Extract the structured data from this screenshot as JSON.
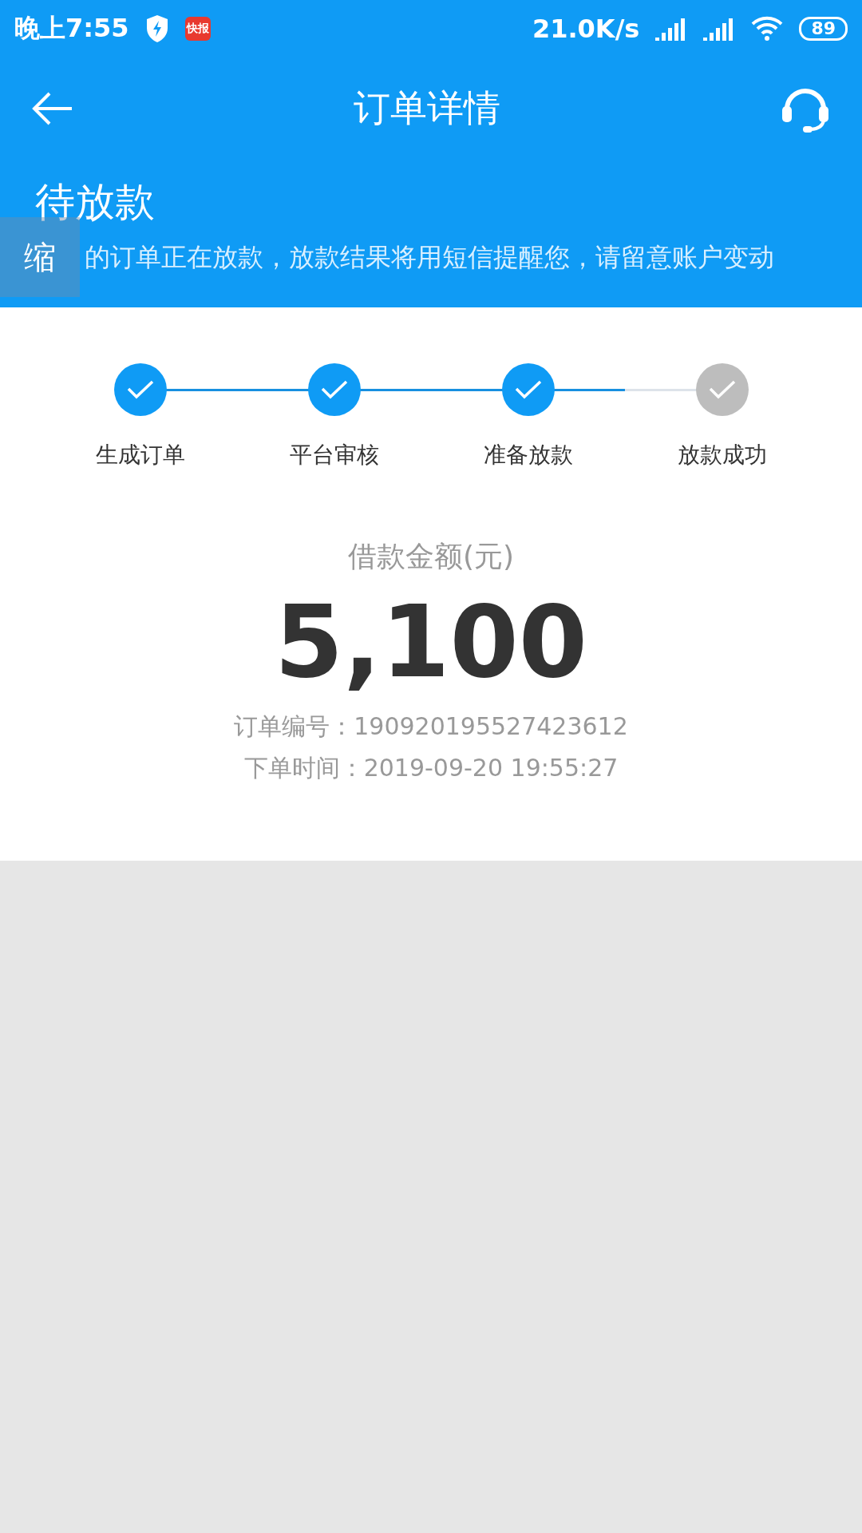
{
  "status_bar": {
    "time": "晚上7:55",
    "notification_badge": "快报",
    "speed": "21.0K/s",
    "battery": "89"
  },
  "header": {
    "title": "订单详情"
  },
  "banner": {
    "status": "待放款",
    "message": "的订单正在放款，放款结果将用短信提醒您，请留意账户变动",
    "float_button": "缩"
  },
  "steps": [
    {
      "label": "生成订单",
      "done": true
    },
    {
      "label": "平台审核",
      "done": true
    },
    {
      "label": "准备放款",
      "done": true
    },
    {
      "label": "放款成功",
      "done": false
    }
  ],
  "amount": {
    "label": "借款金额(元)",
    "value": "5,100"
  },
  "details": [
    {
      "label": "订单编号：",
      "value": "190920195527423612"
    },
    {
      "label": "下单时间：",
      "value": "2019-09-20 19:55:27"
    }
  ]
}
